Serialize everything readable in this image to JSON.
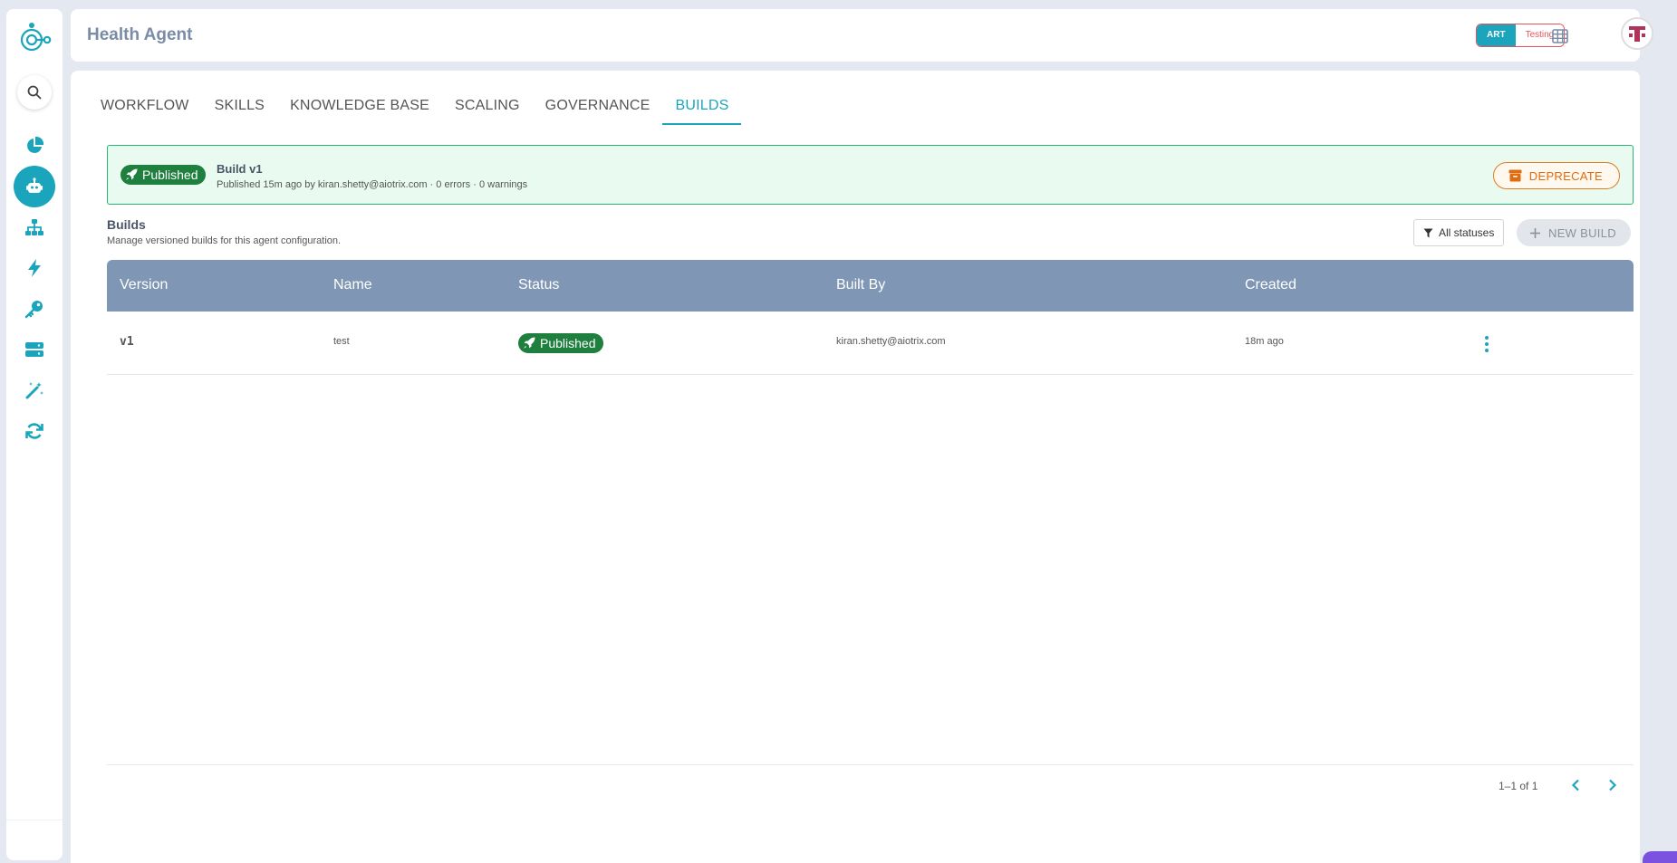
{
  "app": {
    "title": "Health Agent",
    "env": {
      "active": "ART",
      "other": "Testing"
    }
  },
  "sidebar": {
    "items": [
      {
        "icon": "pie-chart-icon"
      },
      {
        "icon": "robot-icon",
        "active": true
      },
      {
        "icon": "hierarchy-icon"
      },
      {
        "icon": "bolt-icon"
      },
      {
        "icon": "key-icon"
      },
      {
        "icon": "server-icon"
      },
      {
        "icon": "magic-wand-icon"
      },
      {
        "icon": "sync-icon"
      }
    ]
  },
  "tabs": [
    {
      "label": "WORKFLOW"
    },
    {
      "label": "SKILLS"
    },
    {
      "label": "KNOWLEDGE BASE"
    },
    {
      "label": "SCALING"
    },
    {
      "label": "GOVERNANCE"
    },
    {
      "label": "BUILDS",
      "active": true
    }
  ],
  "banner": {
    "badge": "Published",
    "title": "Build v1",
    "subtitle": "Published 15m ago by kiran.shetty@aiotrix.com · 0 errors · 0 warnings",
    "deprecate_label": "DEPRECATE"
  },
  "builds": {
    "title": "Builds",
    "subtitle": "Manage versioned builds for this agent configuration.",
    "filter_label": "All statuses",
    "new_build_label": "NEW BUILD",
    "columns": [
      "Version",
      "Name",
      "Status",
      "Built By",
      "Created"
    ],
    "rows": [
      {
        "version": "v1",
        "name": "test",
        "status": "Published",
        "built_by": "kiran.shetty@aiotrix.com",
        "created": "18m ago"
      }
    ]
  },
  "pagination": {
    "range": "1–1 of 1"
  },
  "colors": {
    "accent": "#1aa5bd",
    "published": "#1e7f3f",
    "table_header": "#7f97b4",
    "deprecate": "#e06c10"
  }
}
